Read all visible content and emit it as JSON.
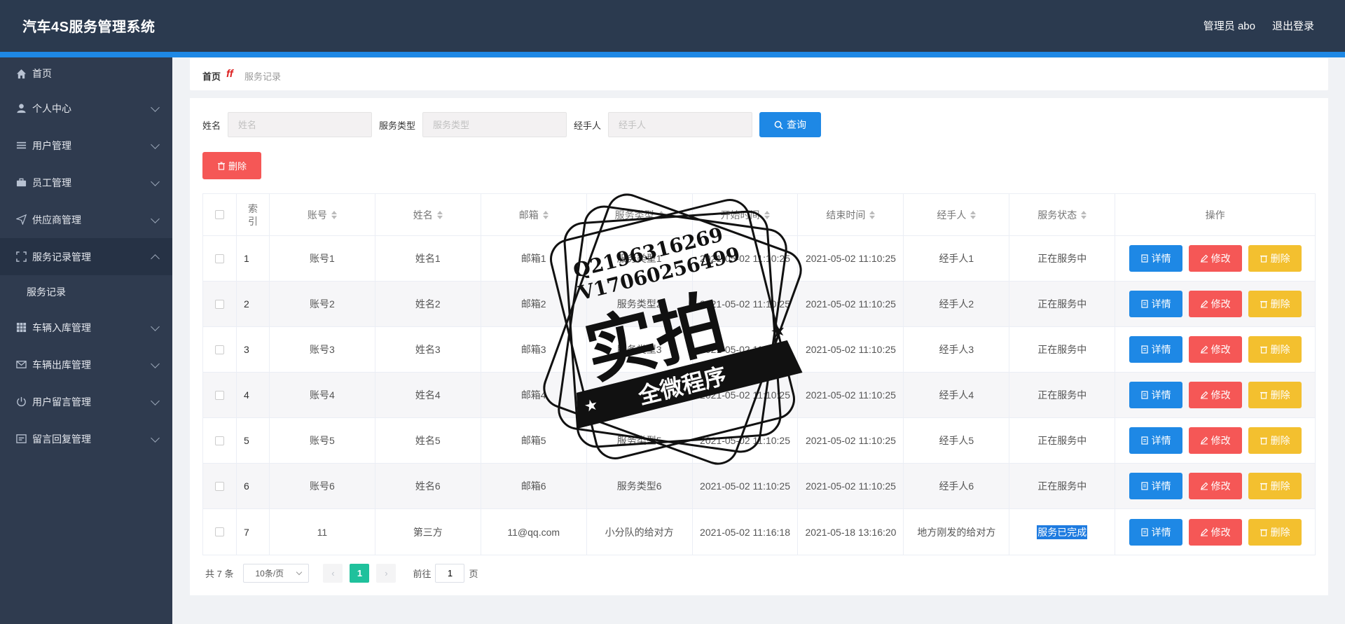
{
  "header": {
    "title": "汽车4S服务管理系统",
    "admin": "管理员 abo",
    "logout": "退出登录"
  },
  "sidebar": {
    "items": [
      {
        "label": "首页",
        "icon": "home-icon"
      },
      {
        "label": "个人中心",
        "icon": "user-icon"
      },
      {
        "label": "用户管理",
        "icon": "list-icon"
      },
      {
        "label": "员工管理",
        "icon": "briefcase-icon"
      },
      {
        "label": "供应商管理",
        "icon": "send-icon"
      },
      {
        "label": "服务记录管理",
        "icon": "fullscreen-icon",
        "open": true
      },
      {
        "label": "车辆入库管理",
        "icon": "grid-icon"
      },
      {
        "label": "车辆出库管理",
        "icon": "mail-icon"
      },
      {
        "label": "用户留言管理",
        "icon": "power-icon"
      },
      {
        "label": "留言回复管理",
        "icon": "message-icon"
      }
    ],
    "sub_item": "服务记录"
  },
  "breadcrumb": {
    "home": "首页",
    "current": "服务记录"
  },
  "search": {
    "name_label": "姓名",
    "name_placeholder": "姓名",
    "type_label": "服务类型",
    "type_placeholder": "服务类型",
    "handler_label": "经手人",
    "handler_placeholder": "经手人",
    "query": "查询"
  },
  "delete_label": "删除",
  "table": {
    "headers": [
      "索引",
      "账号",
      "姓名",
      "邮箱",
      "服务类型",
      "开始时间",
      "结束时间",
      "经手人",
      "服务状态",
      "操作"
    ],
    "rows": [
      {
        "idx": "1",
        "account": "账号1",
        "name": "姓名1",
        "email": "邮箱1",
        "type": "服务类型1",
        "start": "2021-05-02 11:10:25",
        "end": "2021-05-02 11:10:25",
        "handler": "经手人1",
        "status": "正在服务中"
      },
      {
        "idx": "2",
        "account": "账号2",
        "name": "姓名2",
        "email": "邮箱2",
        "type": "服务类型2",
        "start": "2021-05-02 11:10:25",
        "end": "2021-05-02 11:10:25",
        "handler": "经手人2",
        "status": "正在服务中"
      },
      {
        "idx": "3",
        "account": "账号3",
        "name": "姓名3",
        "email": "邮箱3",
        "type": "服务类型3",
        "start": "2021-05-02 11:10:25",
        "end": "2021-05-02 11:10:25",
        "handler": "经手人3",
        "status": "正在服务中"
      },
      {
        "idx": "4",
        "account": "账号4",
        "name": "姓名4",
        "email": "邮箱4",
        "type": "服务类型4",
        "start": "2021-05-02 11:10:25",
        "end": "2021-05-02 11:10:25",
        "handler": "经手人4",
        "status": "正在服务中"
      },
      {
        "idx": "5",
        "account": "账号5",
        "name": "姓名5",
        "email": "邮箱5",
        "type": "服务类型5",
        "start": "2021-05-02 11:10:25",
        "end": "2021-05-02 11:10:25",
        "handler": "经手人5",
        "status": "正在服务中"
      },
      {
        "idx": "6",
        "account": "账号6",
        "name": "姓名6",
        "email": "邮箱6",
        "type": "服务类型6",
        "start": "2021-05-02 11:10:25",
        "end": "2021-05-02 11:10:25",
        "handler": "经手人6",
        "status": "正在服务中"
      },
      {
        "idx": "7",
        "account": "11",
        "name": "第三方",
        "email": "11@qq.com",
        "type": "小分队的给对方",
        "start": "2021-05-02 11:16:18",
        "end": "2021-05-18 13:16:20",
        "handler": "地方刚发的给对方",
        "status": "服务已完成",
        "status_selected": true
      }
    ],
    "ops": {
      "detail": "详情",
      "edit": "修改",
      "delete": "删除"
    }
  },
  "pagination": {
    "total": "共 7 条",
    "page_size": "10条/页",
    "current_page": "1",
    "goto_prefix": "前往",
    "goto_value": "1",
    "goto_suffix": "页"
  },
  "watermark": {
    "line1": "Q2196316269",
    "line2": "V17060256499",
    "big": "实拍",
    "banner": "全微程序"
  },
  "colors": {
    "header_bg": "#2b3a4f",
    "sidebar_bg": "#2f3b4f",
    "primary": "#1e88e5",
    "danger": "#f55756",
    "warning": "#f3c02f",
    "page_active": "#1fc19c"
  }
}
